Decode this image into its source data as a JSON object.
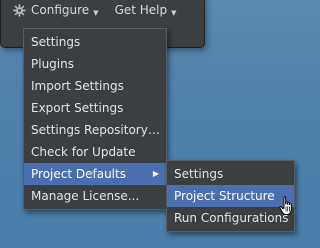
{
  "toolbar": {
    "configure_label": "Configure",
    "get_help_label": "Get Help",
    "configure_icon": "gear-icon",
    "caret_icon": "caret-down-icon"
  },
  "configure_menu": {
    "items": [
      {
        "label": "Settings"
      },
      {
        "label": "Plugins"
      },
      {
        "label": "Import Settings"
      },
      {
        "label": "Export Settings"
      },
      {
        "label": "Settings Repository…"
      },
      {
        "label": "Check for Update"
      },
      {
        "label": "Project Defaults",
        "has_submenu": true,
        "active": true
      },
      {
        "label": "Manage License..."
      }
    ]
  },
  "project_defaults_submenu": {
    "items": [
      {
        "label": "Settings"
      },
      {
        "label": "Project Structure",
        "active": true
      },
      {
        "label": "Run Configurations"
      }
    ]
  },
  "colors": {
    "panel_bg": "#3c3f41",
    "highlight": "#4b6eaf",
    "desktop_bg": "#4f82ac"
  },
  "cursor_icon": "hand-pointer-icon"
}
